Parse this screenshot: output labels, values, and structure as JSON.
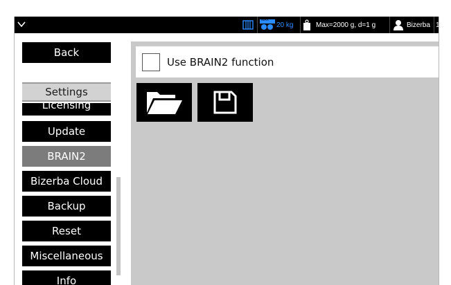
{
  "topbar": {
    "weight_limit_badge": "MAX",
    "weight_limit": "20 kg",
    "scale_info": "Max=2000 g, d=1 g",
    "user": "Bizerba",
    "user_suffix": "1",
    "accent_color": "#2a8cff"
  },
  "sidebar": {
    "back_label": "Back",
    "settings_label": "Settings",
    "items": [
      {
        "label": "Licensing",
        "active": false
      },
      {
        "label": "Update",
        "active": false
      },
      {
        "label": "BRAIN2",
        "active": true
      },
      {
        "label": "Bizerba Cloud",
        "active": false
      },
      {
        "label": "Backup",
        "active": false
      },
      {
        "label": "Reset",
        "active": false
      },
      {
        "label": "Miscellaneous",
        "active": false
      },
      {
        "label": "Info",
        "active": false
      }
    ]
  },
  "main": {
    "option_label": "Use BRAIN2 function",
    "option_checked": false,
    "buttons": [
      {
        "icon": "folder-open-icon"
      },
      {
        "icon": "save-icon"
      }
    ]
  }
}
